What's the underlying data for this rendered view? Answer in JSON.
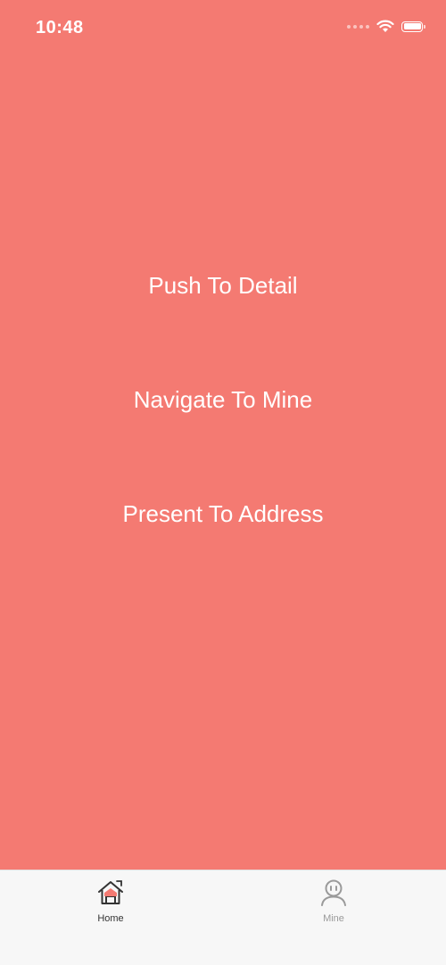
{
  "status_bar": {
    "time": "10:48",
    "wifi_icon": "wifi-icon",
    "battery_icon": "battery-icon"
  },
  "actions": [
    {
      "label": "Push To Detail"
    },
    {
      "label": "Navigate To Mine"
    },
    {
      "label": "Present To Address"
    }
  ],
  "tab_bar": {
    "tabs": [
      {
        "label": "Home",
        "icon": "home-icon",
        "selected": true
      },
      {
        "label": "Mine",
        "icon": "person-icon",
        "selected": false
      }
    ]
  },
  "colors": {
    "background": "#f47a72",
    "tab_bar_background": "#f7f7f7",
    "selected_tab_text": "#333333",
    "unselected_tab_text": "#9a9a9a",
    "action_text": "#ffffff"
  }
}
